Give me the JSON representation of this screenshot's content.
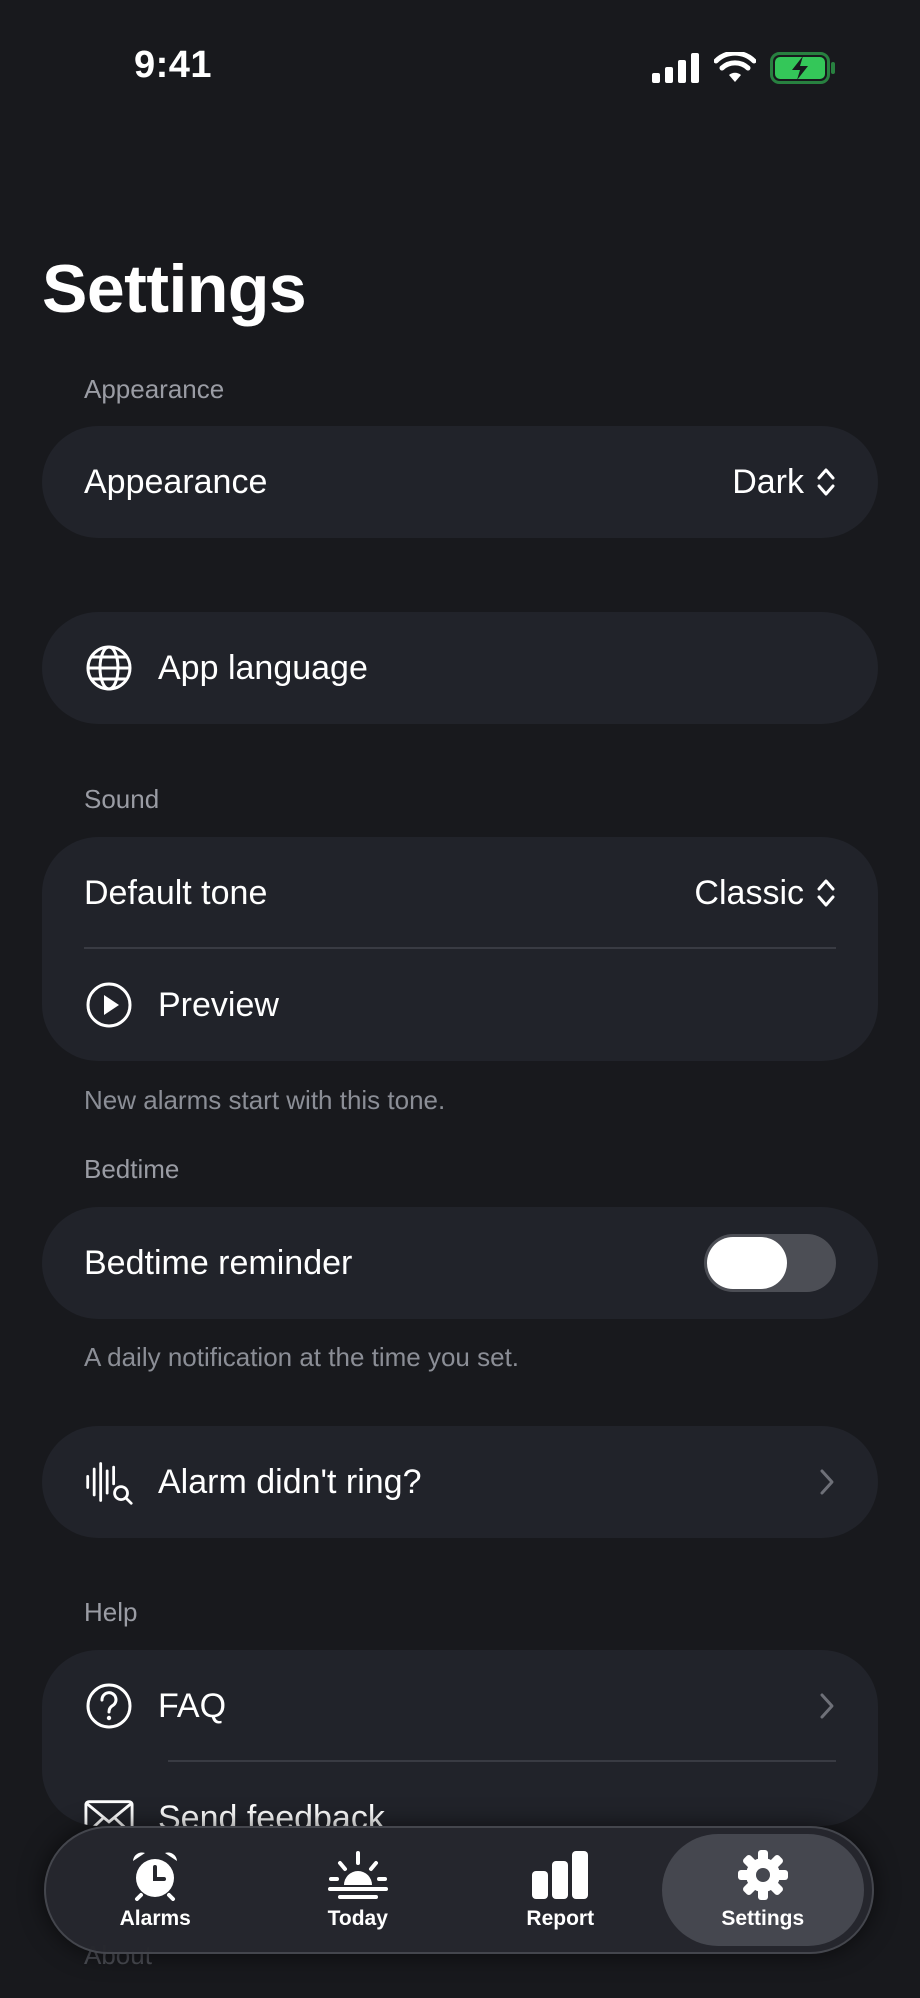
{
  "status_bar": {
    "time": "9:41",
    "icons": [
      "cellular-signal-icon",
      "wifi-icon",
      "battery-charging-icon"
    ],
    "battery_color": "#34c759"
  },
  "page": {
    "title": "Settings"
  },
  "appearance_section": {
    "label": "Appearance",
    "row_label": "Appearance",
    "value": "Dark",
    "value_icon": "chevron-up-down-icon"
  },
  "language": {
    "label": "App language",
    "icon": "globe-icon"
  },
  "sound_section": {
    "label": "Sound",
    "default_tone_label": "Default tone",
    "default_tone_value": "Classic",
    "preview_label": "Preview",
    "preview_icon": "play-circle-icon",
    "footnote": "New alarms start with this tone."
  },
  "bedtime_section": {
    "label": "Bedtime",
    "reminder_label": "Bedtime reminder",
    "reminder_on": false,
    "footnote": "A daily notification at the time you set."
  },
  "alarm_issue": {
    "label": "Alarm didn't ring?",
    "icon": "waveform-search-icon"
  },
  "help_section": {
    "label": "Help",
    "faq_label": "FAQ",
    "feedback_label": "Send feedback"
  },
  "about_section": {
    "label": "About"
  },
  "tab_bar": {
    "active": "Settings",
    "tabs": [
      {
        "label": "Alarms",
        "icon": "alarm-clock-icon"
      },
      {
        "label": "Today",
        "icon": "sunrise-icon"
      },
      {
        "label": "Report",
        "icon": "bar-chart-icon"
      },
      {
        "label": "Settings",
        "icon": "gear-icon"
      }
    ]
  },
  "colors": {
    "background": "#18191d",
    "card": "#21232a",
    "secondary_text": "#9a9ca4",
    "active_tab": "#45474f"
  }
}
